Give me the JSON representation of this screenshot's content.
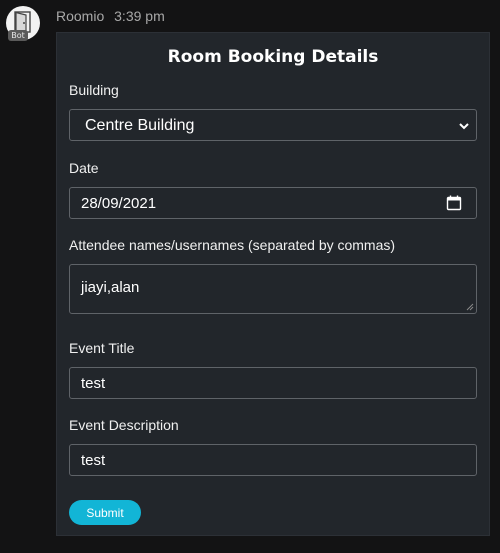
{
  "message": {
    "author": "Roomio",
    "time": "3:39 pm",
    "badge": "Bot",
    "avatar_icon": "door-icon"
  },
  "form": {
    "title": "Room Booking Details",
    "building": {
      "label": "Building",
      "selected": "Centre Building",
      "icon": "chevron-down-icon"
    },
    "date": {
      "label": "Date",
      "value": "28/09/2021",
      "icon": "calendar-icon"
    },
    "attendees": {
      "label": "Attendee names/usernames (separated by commas)",
      "value": "jiayi,alan"
    },
    "event_title": {
      "label": "Event Title",
      "value": "test"
    },
    "event_description": {
      "label": "Event Description",
      "value": "test"
    },
    "submit_label": "Submit"
  },
  "colors": {
    "background": "#131314",
    "card": "#22262b",
    "field_border": "#5f6368",
    "accent": "#12b5d6"
  }
}
